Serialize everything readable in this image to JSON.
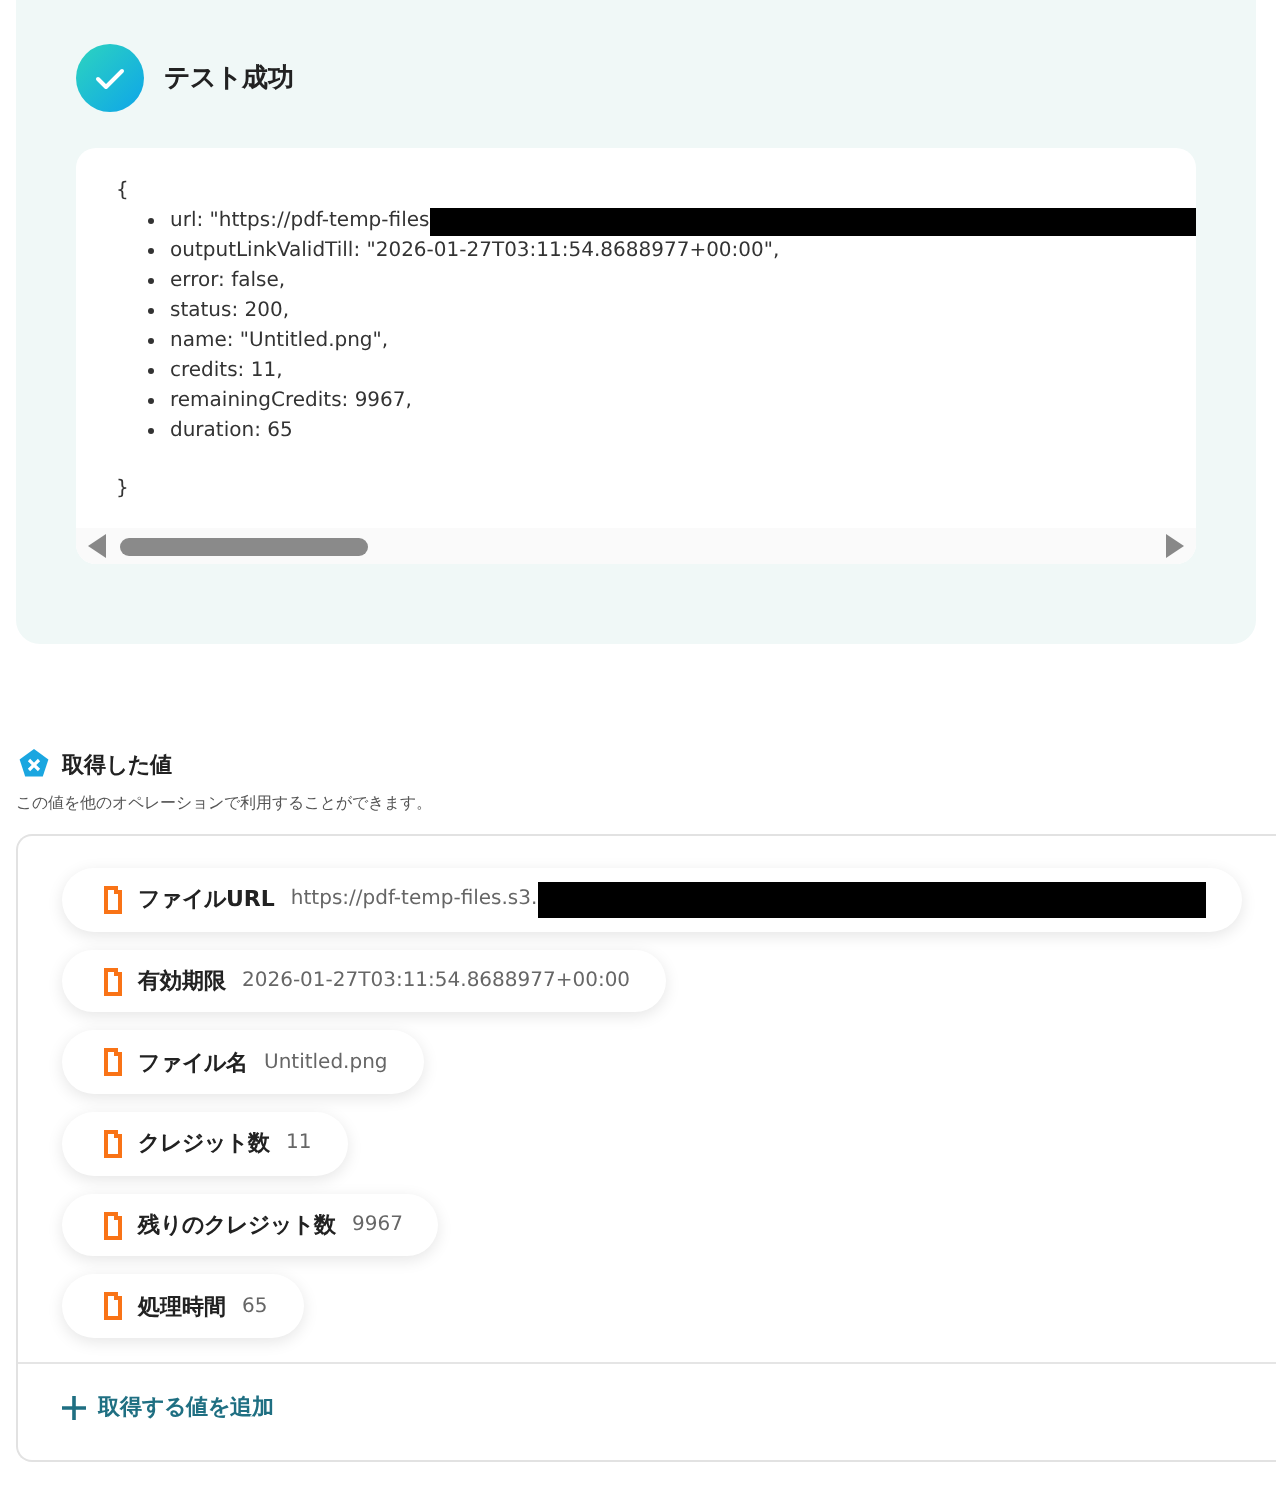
{
  "test_result": {
    "success": true,
    "title": "テスト成功",
    "open_brace": "{",
    "lines": [
      {
        "text": "url: \"https://pdf-temp-files",
        "redacted": true
      },
      {
        "text": "outputLinkValidTill: \"2026-01-27T03:11:54.8688977+00:00\",",
        "redacted": false
      },
      {
        "text": "error: false,",
        "redacted": false
      },
      {
        "text": "status: 200,",
        "redacted": false
      },
      {
        "text": "name: \"Untitled.png\",",
        "redacted": false
      },
      {
        "text": "credits: 11,",
        "redacted": false
      },
      {
        "text": "remainingCredits: 9967,",
        "redacted": false
      },
      {
        "text": "duration: 65",
        "redacted": false
      }
    ],
    "close_brace": "}"
  },
  "values": {
    "title": "取得した値",
    "subtitle": "この値を他のオペレーションで利用することができます。",
    "items": [
      {
        "label": "ファイルURL",
        "value": "https://pdf-temp-files.s3.",
        "redacted": true
      },
      {
        "label": "有効期限",
        "value": "2026-01-27T03:11:54.8688977+00:00",
        "redacted": false
      },
      {
        "label": "ファイル名",
        "value": "Untitled.png",
        "redacted": false
      },
      {
        "label": "クレジット数",
        "value": "11",
        "redacted": false
      },
      {
        "label": "残りのクレジット数",
        "value": "9967",
        "redacted": false
      },
      {
        "label": "処理時間",
        "value": "65",
        "redacted": false
      }
    ],
    "add_button": "取得する値を追加"
  }
}
